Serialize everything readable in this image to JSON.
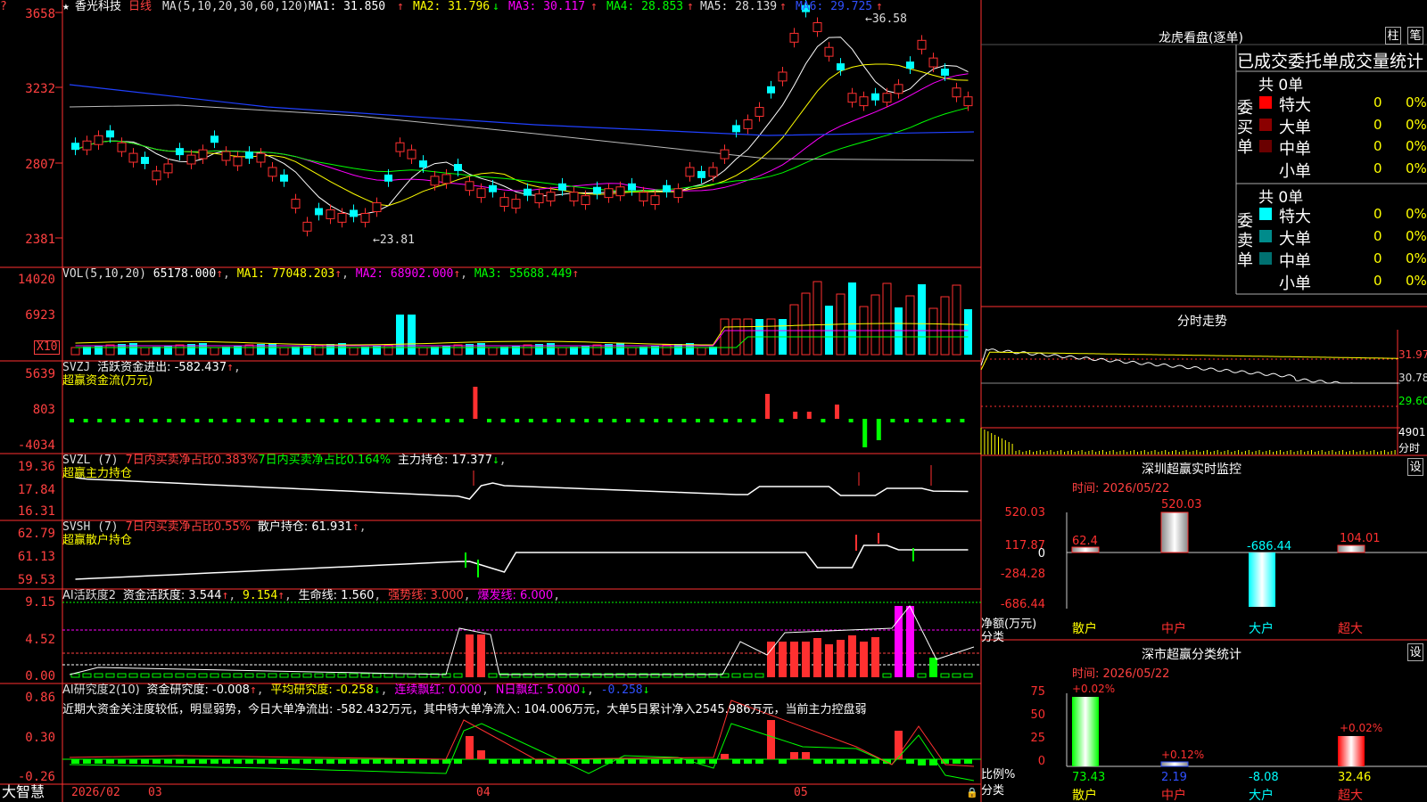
{
  "stock": {
    "name": "香光科技",
    "period": "日线"
  },
  "main_header": {
    "prefix": "★",
    "ma_params": "MA(5,10,20,30,60,120)",
    "ma1": "MA1: 31.850",
    "ma2": "MA2: 31.796",
    "ma3": "MA3: 30.117",
    "ma4": "MA4: 28.853",
    "ma5": "MA5: 28.139",
    "ma6": "MA6: 29.725",
    "high_label": "36.58",
    "low_label": "23.81",
    "yticks": [
      "3658",
      "3232",
      "2807",
      "2381"
    ]
  },
  "vol_header": {
    "params": "VOL(5,10,20)",
    "vol": "65178.000",
    "ma1": "MA1: 77048.203",
    "ma2": "MA2: 68902.000",
    "ma3": "MA3: 55688.449",
    "yticks": [
      "14020",
      "6923"
    ],
    "unit": "X10"
  },
  "svzj": {
    "name": "SVZJ",
    "title": "活跃资金进出: -582.437",
    "subtitle": "超赢资金流(万元)",
    "yticks": [
      "5639",
      "803",
      "-4034"
    ]
  },
  "svzl": {
    "name": "SVZL (7)",
    "t1": "7日内买卖净占比0.383%",
    "t2": "7日内买卖净占比0.164%",
    "t3": "主力持仓: 17.377",
    "subtitle": "超赢主力持仓",
    "yticks": [
      "19.36",
      "17.84",
      "16.31"
    ]
  },
  "svsh": {
    "name": "SVSH (7)",
    "t1": "7日内买卖净占比0.55%",
    "t2": "散户持仓: 61.931",
    "subtitle": "超赢散户持仓",
    "yticks": [
      "62.79",
      "61.13",
      "59.53"
    ]
  },
  "ai1": {
    "name": "AI活跃度2",
    "t1": "资金活跃度: 3.544",
    "t2": "9.154",
    "t3": "生命线: 1.560",
    "t4": "强势线: 3.000",
    "t5": "爆发线: 6.000",
    "yticks": [
      "9.15",
      "4.52",
      "0.00"
    ]
  },
  "ai2": {
    "name": "AI研究度2(10)",
    "t1": "资金研究度: -0.008",
    "t2": "平均研究度: -0.258",
    "t3": "连续飘红: 0.000",
    "t4": "N日飘红: 5.000",
    "t5": "-0.258",
    "comment": "近期大资金关注度较低，明显弱势，今日大单净流出: -582.432万元，其中特大单净流入: 104.006万元，大单5日累计净入2545.986万元，当前主力控盘弱",
    "yticks": [
      "0.86",
      "0.30",
      "-0.26"
    ]
  },
  "footer": {
    "brand": "大智慧",
    "dates": [
      "2026/02",
      "03",
      "04",
      "05"
    ]
  },
  "lhb": {
    "title": "龙虎看盘(逐单)",
    "btn1": "柱",
    "btn2": "笔",
    "subtitle": "已成交委托单成交量统计",
    "buy": {
      "side": "委买单",
      "total": "共 0单",
      "rows": [
        {
          "k": "特大",
          "c": "#ff0000",
          "v": "0",
          "p": "0%"
        },
        {
          "k": "大单",
          "c": "#8b0000",
          "v": "0",
          "p": "0%"
        },
        {
          "k": "中单",
          "c": "#6a0000",
          "v": "0",
          "p": "0%"
        },
        {
          "k": "小单",
          "c": "",
          "v": "0",
          "p": "0%"
        }
      ]
    },
    "sell": {
      "side": "委卖单",
      "total": "共 0单",
      "rows": [
        {
          "k": "特大",
          "c": "#00ffff",
          "v": "0",
          "p": "0%"
        },
        {
          "k": "大单",
          "c": "#008b8b",
          "v": "0",
          "p": "0%"
        },
        {
          "k": "中单",
          "c": "#007070",
          "v": "0",
          "p": "0%"
        },
        {
          "k": "小单",
          "c": "",
          "v": "0",
          "p": "0%"
        }
      ]
    }
  },
  "fs": {
    "title": "分时走势",
    "y": [
      "31.97",
      "30.78",
      "29.60"
    ],
    "vol": "4901",
    "unit": "分时"
  },
  "sz": {
    "title": "深圳超赢实时监控",
    "btn": "设",
    "date": "时间: 2026/05/22",
    "yticks": [
      "520.03",
      "117.87",
      "0",
      "-284.28",
      "-686.44"
    ],
    "ylabel": "净额(万元)",
    "xlabel": "分类",
    "cats": [
      "散户",
      "中户",
      "大户",
      "超大"
    ],
    "bar_labels": [
      "62.4",
      "520.03",
      "-686.44",
      "104.01"
    ]
  },
  "sc": {
    "title": "深市超赢分类统计",
    "btn": "设",
    "date": "时间: 2026/05/22",
    "yticks": [
      "75",
      "50",
      "25",
      "0"
    ],
    "ylabel": "比例%",
    "xlabel": "分类",
    "cats": [
      "散户",
      "中户",
      "大户",
      "超大"
    ],
    "top_labels": [
      "+0.02%",
      "+0.12%",
      "+0.02%"
    ],
    "bot_labels": [
      "73.43",
      "2.19",
      "-8.08",
      "32.46"
    ]
  }
}
